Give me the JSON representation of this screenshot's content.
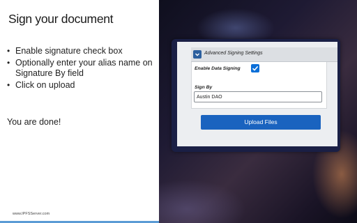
{
  "slide": {
    "title": "Sign your document",
    "bullets": [
      "Enable signature check box",
      "Optionally enter your alias name on Signature By field",
      "Click on upload"
    ],
    "done_text": "You are done!",
    "footer_url": "www.IPFSServer.com",
    "accent_color": "#5b9bd5"
  },
  "screen": {
    "advanced_section_label": "Advanced Signing Settings",
    "toggle_icon": "chevron-down-icon",
    "enable_signing_label": "Enable Data Signing",
    "enable_signing_checked": true,
    "sign_by_label": "Sign By",
    "sign_by_value": "Austin DAO",
    "upload_button_label": "Upload Files",
    "button_color": "#1a63bf"
  }
}
